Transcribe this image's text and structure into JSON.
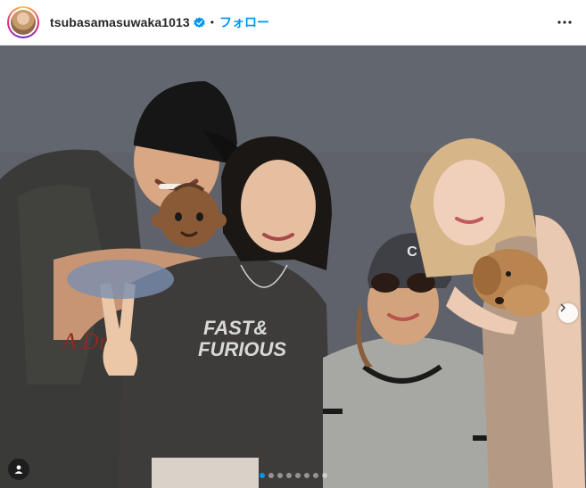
{
  "post_header": {
    "username": "tsubasamasuwaka1013",
    "separator": "•",
    "follow_label": "フォロー"
  },
  "photo": {
    "shirt_text_line1": "FAST&",
    "shirt_text_line2": "FURIOUS",
    "cap_logo": "C",
    "emoji": "baby-emoji-medium-dark-skin"
  },
  "carousel": {
    "slide_count": 8,
    "active_index": 0
  },
  "colors": {
    "accent": "#0095f6",
    "text": "#262626"
  },
  "icons": [
    "verified-badge-icon",
    "more-options-icon",
    "chevron-right-icon",
    "user-tag-icon"
  ]
}
